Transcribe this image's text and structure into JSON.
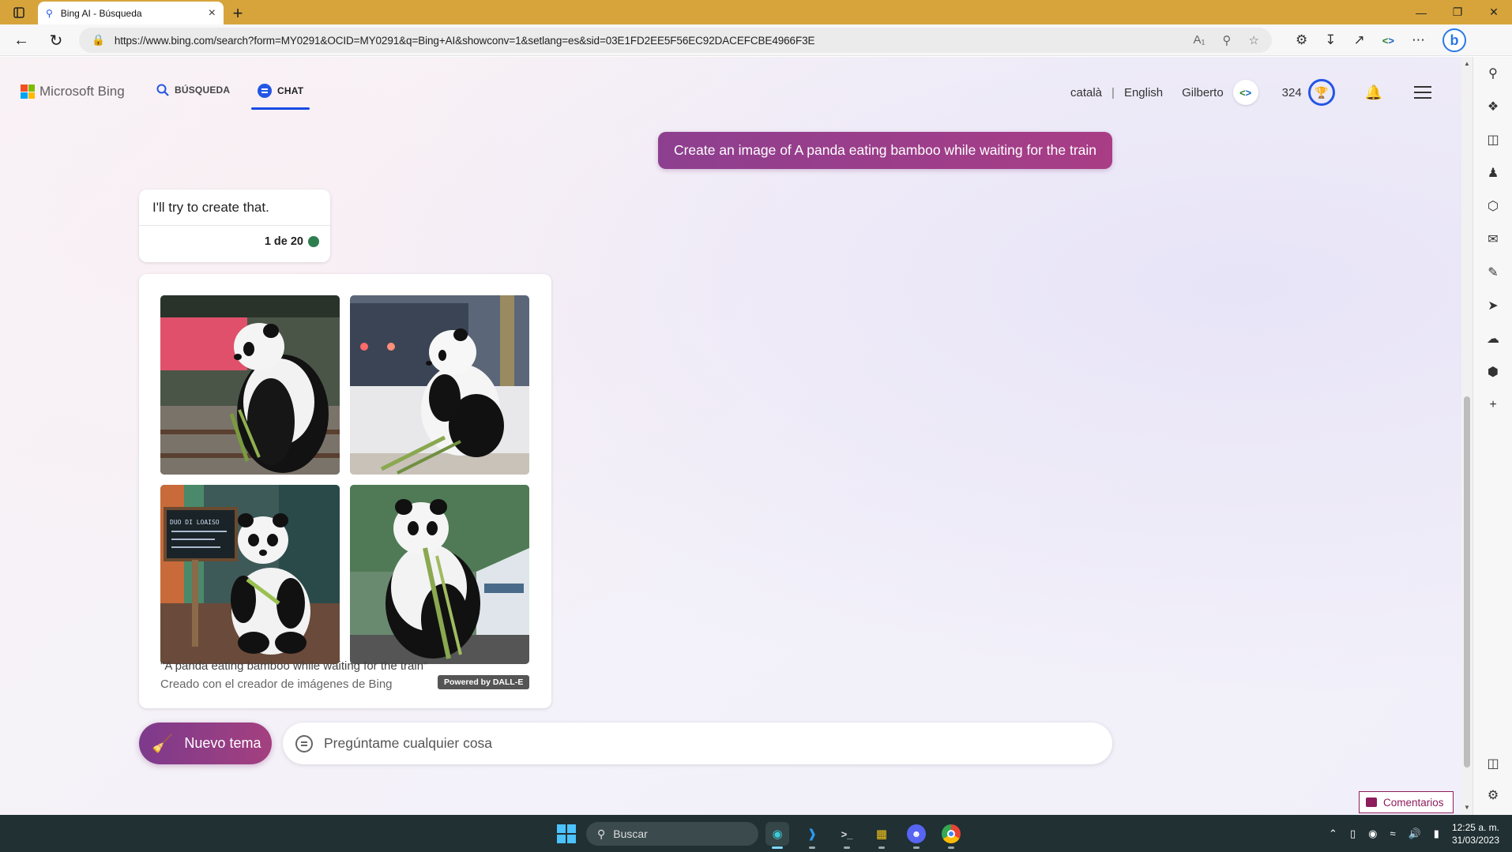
{
  "browser": {
    "tab_title": "Bing AI - Búsqueda",
    "url": "https://www.bing.com/search?form=MY0291&OCID=MY0291&q=Bing+AI&showconv=1&setlang=es&sid=03E1FD2EE5F56EC92DACEFCBE4966F3E"
  },
  "header": {
    "logo": "Microsoft Bing",
    "nav_search": "BÚSQUEDA",
    "nav_chat": "CHAT",
    "lang_catala": "català",
    "lang_separator": "|",
    "lang_english": "English",
    "user_name": "Gilberto",
    "points": "324"
  },
  "chat": {
    "user_message": "Create an image of A panda eating bamboo while waiting for the train",
    "bot_message": "I'll try to create that.",
    "counter": "1 de 20",
    "image_caption": "\"A panda eating bamboo while waiting for the train\"",
    "image_sub_caption": "Creado con el creador de imágenes de Bing",
    "dalle_badge": "Powered by DALL-E",
    "chalkboard_text": "DUO DI LOAISO"
  },
  "input": {
    "new_topic": "Nuevo tema",
    "placeholder": "Pregúntame cualquier cosa"
  },
  "feedback": "Comentarios",
  "taskbar": {
    "search": "Buscar",
    "time": "12:25 a. m.",
    "date": "31/03/2023"
  },
  "colors": {
    "accent": "#174ae4",
    "bubble": "#9c3e8a",
    "titlebar": "#d7a43c"
  }
}
